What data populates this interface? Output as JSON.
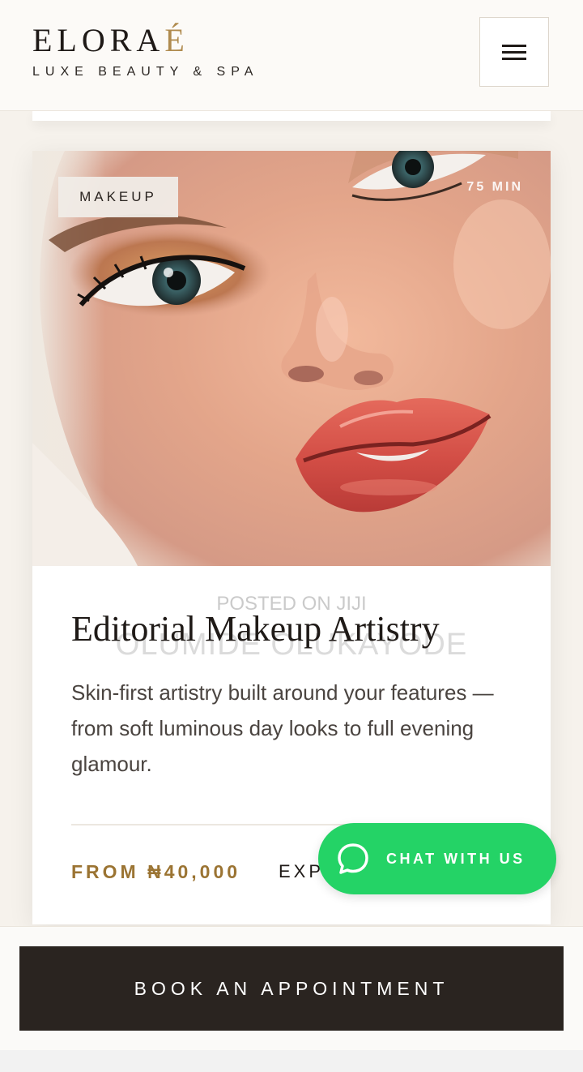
{
  "header": {
    "logo_main": "ELORA",
    "logo_accent": "É",
    "logo_sub": "LUXE BEAUTY & SPA"
  },
  "card": {
    "category": "MAKEUP",
    "duration": "75 MIN",
    "watermark_top": "POSTED ON JIJI",
    "watermark_name": "OLUMIDE OLUKAYODE",
    "title": "Editorial Makeup Artistry",
    "description": "Skin-first artistry built around your features — from soft luminous day looks to full evening glamour.",
    "price": "FROM ₦40,000",
    "explore": "EXP"
  },
  "chat": {
    "label": "CHAT WITH US",
    "color": "#24d366"
  },
  "footer": {
    "book_label": "BOOK AN APPOINTMENT"
  },
  "colors": {
    "accent": "#b08b4f",
    "dark": "#2a2420"
  },
  "icons": [
    "menu-icon",
    "chat-bubble-icon"
  ]
}
